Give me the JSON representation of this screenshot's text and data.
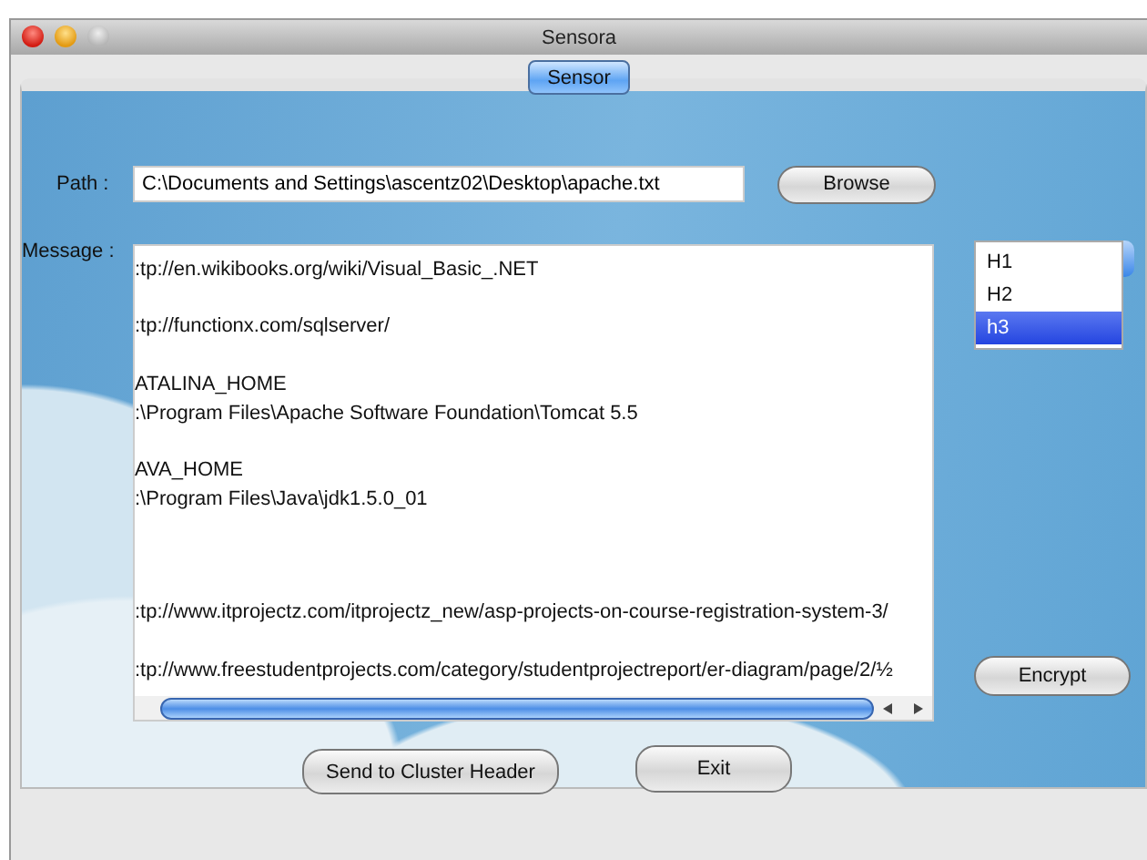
{
  "window": {
    "title": "Sensora"
  },
  "tabs": [
    {
      "label": "Sensor",
      "selected": true
    }
  ],
  "path": {
    "label": "Path :",
    "value": "C:\\Documents and Settings\\ascentz02\\Desktop\\apache.txt",
    "browse_button": "Browse"
  },
  "message": {
    "label": "Message :",
    "value": ":tp://en.wikibooks.org/wiki/Visual_Basic_.NET\n\n:tp://functionx.com/sqlserver/\n\nATALINA_HOME\n:\\Program Files\\Apache Software Foundation\\Tomcat 5.5\n\nAVA_HOME\n:\\Program Files\\Java\\jdk1.5.0_01\n\n\n\n:tp://www.itprojectz.com/itprojectz_new/asp-projects-on-course-registration-system-3/\n\n:tp://www.freestudentprojects.com/category/studentprojectreport/er-diagram/page/2/½"
  },
  "dropdown": {
    "options": [
      {
        "label": "H1",
        "selected": false
      },
      {
        "label": "H2",
        "selected": false
      },
      {
        "label": "h3",
        "selected": true
      }
    ]
  },
  "buttons": {
    "encrypt": "Encrypt",
    "send": "Send to Cluster Header",
    "exit": "Exit"
  }
}
